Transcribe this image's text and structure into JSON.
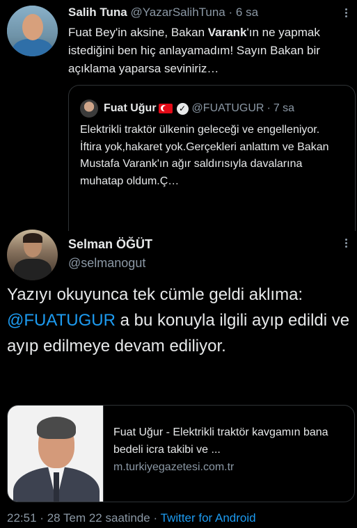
{
  "tweet1": {
    "name": "Salih Tuna",
    "handle": "@YazarSalihTuna",
    "separator": "·",
    "time": "6 sa",
    "text_before": "Fuat Bey'in aksine, Bakan ",
    "text_bold": "Varank",
    "text_after": "'ın ne yapmak istediğini ben hiç anlayamadım! Sayın Bakan bir açıklama yaparsa seviniriz…"
  },
  "quote": {
    "name": "Fuat Uğur",
    "verified_glyph": "✓",
    "handle": "@FUATUGUR",
    "separator": "·",
    "time": "7 sa",
    "text_line1": "Elektrikli traktör ülkenin geleceği ve engelleniyor.",
    "text_line2": "İftira yok,hakaret yok.Gerçekleri anlattım ve Bakan Mustafa Varank'ın ağır saldırısıyla davalarına muhatap oldum.Ç…"
  },
  "tweet2": {
    "name": "Selman ÖĞÜT",
    "handle": "@selmanogut",
    "text_before": "Yazıyı okuyunca tek cümle geldi aklıma: ",
    "mention": "@FUATUGUR",
    "text_after": " a bu konuyla ilgili ayıp edildi ve ayıp edilmeye devam ediliyor."
  },
  "card": {
    "title": "Fuat Uğur - Elektrikli traktör kavgamın bana bedeli icra takibi ve ...",
    "domain": "m.turkiyegazetesi.com.tr"
  },
  "footer": {
    "time": "22:51",
    "date": "28 Tem 22 saatinde",
    "separator": "·",
    "source": "Twitter for Android"
  },
  "icons": [
    "more-options-icon",
    "verified-badge-icon",
    "turkey-flag-icon"
  ],
  "colors": {
    "background": "#000000",
    "text": "#e7e9ea",
    "muted": "#8b98a5",
    "link": "#1d9bf0",
    "border": "#2f3336"
  }
}
